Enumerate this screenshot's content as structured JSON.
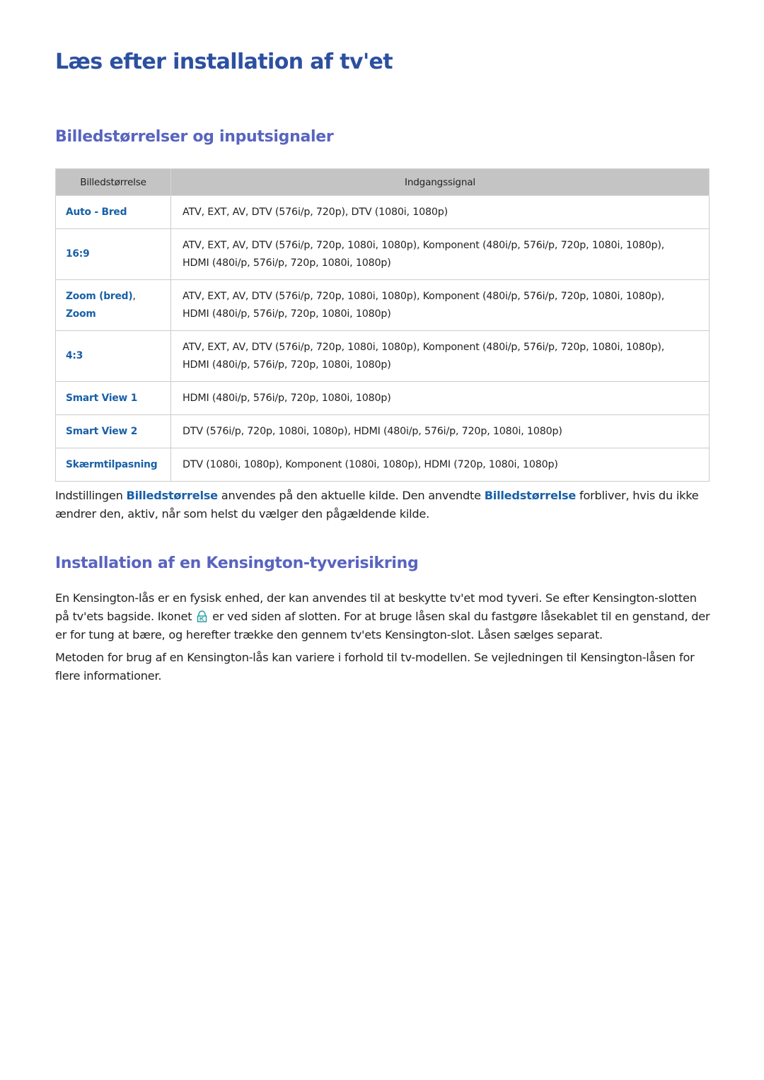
{
  "page": {
    "title": "Læs efter installation af tv'et"
  },
  "section_picture_size": {
    "heading": "Billedstørrelser og inputsignaler",
    "table": {
      "headers": [
        "Billedstørrelse",
        "Indgangssignal"
      ],
      "rows": [
        {
          "size": [
            "Auto - Bred"
          ],
          "signal": [
            "ATV, EXT, AV, DTV (576i/p, 720p), DTV (1080i, 1080p)"
          ]
        },
        {
          "size": [
            "16:9"
          ],
          "signal": [
            "ATV, EXT, AV, DTV (576i/p, 720p, 1080i, 1080p), Komponent (480i/p, 576i/p, 720p, 1080i, 1080p),",
            "HDMI (480i/p, 576i/p, 720p, 1080i, 1080p)"
          ]
        },
        {
          "size": [
            "Zoom (bred)",
            "Zoom"
          ],
          "signal": [
            "ATV, EXT, AV, DTV (576i/p, 720p, 1080i, 1080p), Komponent (480i/p, 576i/p, 720p, 1080i, 1080p),",
            "HDMI (480i/p, 576i/p, 720p, 1080i, 1080p)"
          ]
        },
        {
          "size": [
            "4:3"
          ],
          "signal": [
            "ATV, EXT, AV, DTV (576i/p, 720p, 1080i, 1080p), Komponent (480i/p, 576i/p, 720p, 1080i, 1080p),",
            "HDMI (480i/p, 576i/p, 720p, 1080i, 1080p)"
          ]
        },
        {
          "size": [
            "Smart View 1"
          ],
          "signal": [
            "HDMI (480i/p, 576i/p, 720p, 1080i, 1080p)"
          ]
        },
        {
          "size": [
            "Smart View 2"
          ],
          "signal": [
            "DTV (576i/p, 720p, 1080i, 1080p), HDMI (480i/p, 576i/p, 720p, 1080i, 1080p)"
          ]
        },
        {
          "size": [
            "Skærmtilpasning"
          ],
          "signal": [
            "DTV (1080i, 1080p), Komponent (1080i, 1080p), HDMI (720p, 1080i, 1080p)"
          ]
        }
      ]
    },
    "note": {
      "part1": "Indstillingen ",
      "term1": "Billedstørrelse",
      "part2": " anvendes på den aktuelle kilde. Den anvendte ",
      "term2": "Billedstørrelse",
      "part3": " forbliver, hvis du ikke ændrer den, aktiv, når som helst du vælger den pågældende kilde."
    }
  },
  "section_kensington": {
    "heading": "Installation af en Kensington-tyverisikring",
    "para1_before_icon": "En Kensington-lås er en fysisk enhed, der kan anvendes til at beskytte tv'et mod tyveri. Se efter Kensington-slotten på tv'ets bagside. Ikonet",
    "icon": "kensington-lock-icon",
    "para1_after_icon": "er ved siden af slotten. For at bruge låsen skal du fastgøre låsekablet til en genstand, der er for tung at bære, og herefter trække den gennem tv'ets Kensington-slot. Låsen sælges separat.",
    "para2": "Metoden for brug af en Kensington-lås kan variere i forhold til tv-modellen. Se vejledningen til Kensington-låsen for flere informationer."
  },
  "colors": {
    "title": "#2c50a0",
    "section_heading": "#5864bf",
    "highlight": "#1860a8",
    "table_header_bg": "#c4c4c4",
    "icon": "#1e9aa0"
  }
}
